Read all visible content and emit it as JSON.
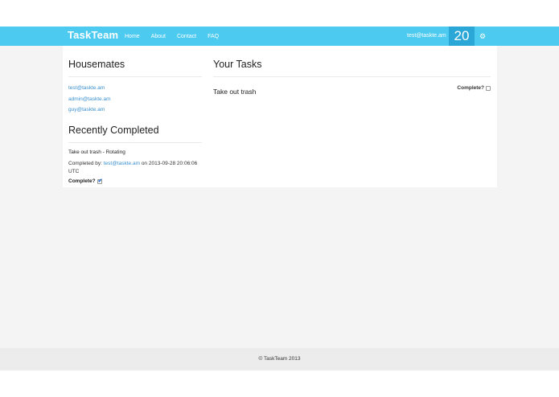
{
  "navbar": {
    "brand": "TaskTeam",
    "links": [
      "Home",
      "About",
      "Contact",
      "FAQ"
    ],
    "user_email": "test@taskte.am",
    "score": "20",
    "settings_icon": "gear-icon"
  },
  "housemates": {
    "heading": "Housemates",
    "members": [
      "test@taskte.am",
      "admin@taskte.am",
      "guy@taskte.am"
    ]
  },
  "recently_completed": {
    "heading": "Recently Completed",
    "items": [
      {
        "title": "Take out trash - Rotating",
        "completed_by_label": "Completed by:",
        "completed_by": "test@taskte.am",
        "on_label": "on",
        "timestamp": "2013-09-28 20:06:06 UTC",
        "complete_label": "Complete?",
        "complete": true
      }
    ]
  },
  "tasks": {
    "heading": "Your Tasks",
    "items": [
      {
        "title": "Take out trash",
        "complete_label": "Complete?",
        "complete": false
      }
    ]
  },
  "footer": {
    "text": "© TaskTeam 2013"
  },
  "colors": {
    "navbar": "#4ccaf0",
    "score_box": "#2aa7d6",
    "link": "#3a8fd0",
    "page_bg": "#f4f4f4"
  }
}
